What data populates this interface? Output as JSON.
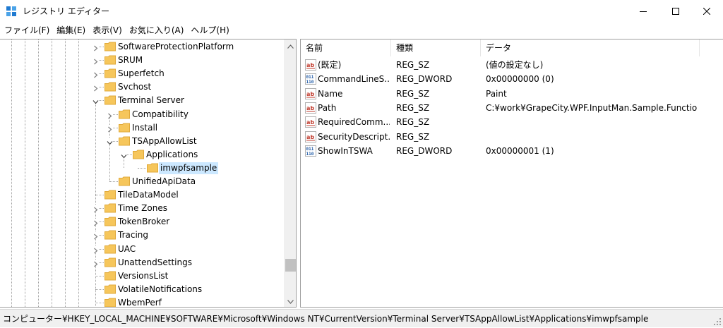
{
  "window": {
    "title": "レジストリ エディター",
    "icon": "registry-editor-icon",
    "controls": [
      "minimize-icon",
      "maximize-icon",
      "close-icon"
    ]
  },
  "menu": [
    {
      "label": "ファイル(F)"
    },
    {
      "label": "編集(E)"
    },
    {
      "label": "表示(V)"
    },
    {
      "label": "お気に入り(A)"
    },
    {
      "label": "ヘルプ(H)"
    }
  ],
  "tree": {
    "items": [
      {
        "label": "SoftwareProtectionPlatform",
        "level": 0,
        "expandable": true,
        "expanded": false,
        "selected": false
      },
      {
        "label": "SRUM",
        "level": 0,
        "expandable": true,
        "expanded": false,
        "selected": false
      },
      {
        "label": "Superfetch",
        "level": 0,
        "expandable": true,
        "expanded": false,
        "selected": false
      },
      {
        "label": "Svchost",
        "level": 0,
        "expandable": true,
        "expanded": false,
        "selected": false
      },
      {
        "label": "Terminal Server",
        "level": 0,
        "expandable": true,
        "expanded": true,
        "selected": false
      },
      {
        "label": "Compatibility",
        "level": 1,
        "expandable": true,
        "expanded": false,
        "selected": false
      },
      {
        "label": "Install",
        "level": 1,
        "expandable": true,
        "expanded": false,
        "selected": false
      },
      {
        "label": "TSAppAllowList",
        "level": 1,
        "expandable": true,
        "expanded": true,
        "selected": false
      },
      {
        "label": "Applications",
        "level": 2,
        "expandable": true,
        "expanded": true,
        "selected": false
      },
      {
        "label": "imwpfsample",
        "level": 3,
        "expandable": false,
        "expanded": false,
        "selected": true
      },
      {
        "label": "UnifiedApiData",
        "level": 1,
        "expandable": false,
        "expanded": false,
        "selected": false
      },
      {
        "label": "TileDataModel",
        "level": 0,
        "expandable": false,
        "expanded": false,
        "selected": false
      },
      {
        "label": "Time Zones",
        "level": 0,
        "expandable": true,
        "expanded": false,
        "selected": false
      },
      {
        "label": "TokenBroker",
        "level": 0,
        "expandable": true,
        "expanded": false,
        "selected": false
      },
      {
        "label": "Tracing",
        "level": 0,
        "expandable": true,
        "expanded": false,
        "selected": false
      },
      {
        "label": "UAC",
        "level": 0,
        "expandable": true,
        "expanded": false,
        "selected": false
      },
      {
        "label": "UnattendSettings",
        "level": 0,
        "expandable": true,
        "expanded": false,
        "selected": false
      },
      {
        "label": "VersionsList",
        "level": 0,
        "expandable": false,
        "expanded": false,
        "selected": false
      },
      {
        "label": "VolatileNotifications",
        "level": 0,
        "expandable": false,
        "expanded": false,
        "selected": false
      },
      {
        "label": "WbemPerf",
        "level": 0,
        "expandable": false,
        "expanded": false,
        "selected": false
      }
    ]
  },
  "list": {
    "columns": [
      "名前",
      "種類",
      "データ"
    ],
    "rows": [
      {
        "icon": "string-value-icon",
        "name": "(既定)",
        "type": "REG_SZ",
        "data": "(値の設定なし)"
      },
      {
        "icon": "binary-value-icon",
        "name": "CommandLineS...",
        "type": "REG_DWORD",
        "data": "0x00000000 (0)"
      },
      {
        "icon": "string-value-icon",
        "name": "Name",
        "type": "REG_SZ",
        "data": "Paint"
      },
      {
        "icon": "string-value-icon",
        "name": "Path",
        "type": "REG_SZ",
        "data": "C:¥work¥GrapeCity.WPF.InputMan.Sample.Functio..."
      },
      {
        "icon": "string-value-icon",
        "name": "RequiredComm...",
        "type": "REG_SZ",
        "data": ""
      },
      {
        "icon": "string-value-icon",
        "name": "SecurityDescript...",
        "type": "REG_SZ",
        "data": ""
      },
      {
        "icon": "binary-value-icon",
        "name": "ShowInTSWA",
        "type": "REG_DWORD",
        "data": "0x00000001 (1)"
      }
    ]
  },
  "status": {
    "path": "コンピューター¥HKEY_LOCAL_MACHINE¥SOFTWARE¥Microsoft¥Windows NT¥CurrentVersion¥Terminal Server¥TSAppAllowList¥Applications¥imwpfsample"
  },
  "colors": {
    "selection": "#cce8ff",
    "folder": "#f6c65b",
    "border": "#a0a0a0",
    "statusbar": "#f0f0f0",
    "string_icon_red": "#c0392b",
    "binary_icon_blue": "#1f5aa6"
  }
}
